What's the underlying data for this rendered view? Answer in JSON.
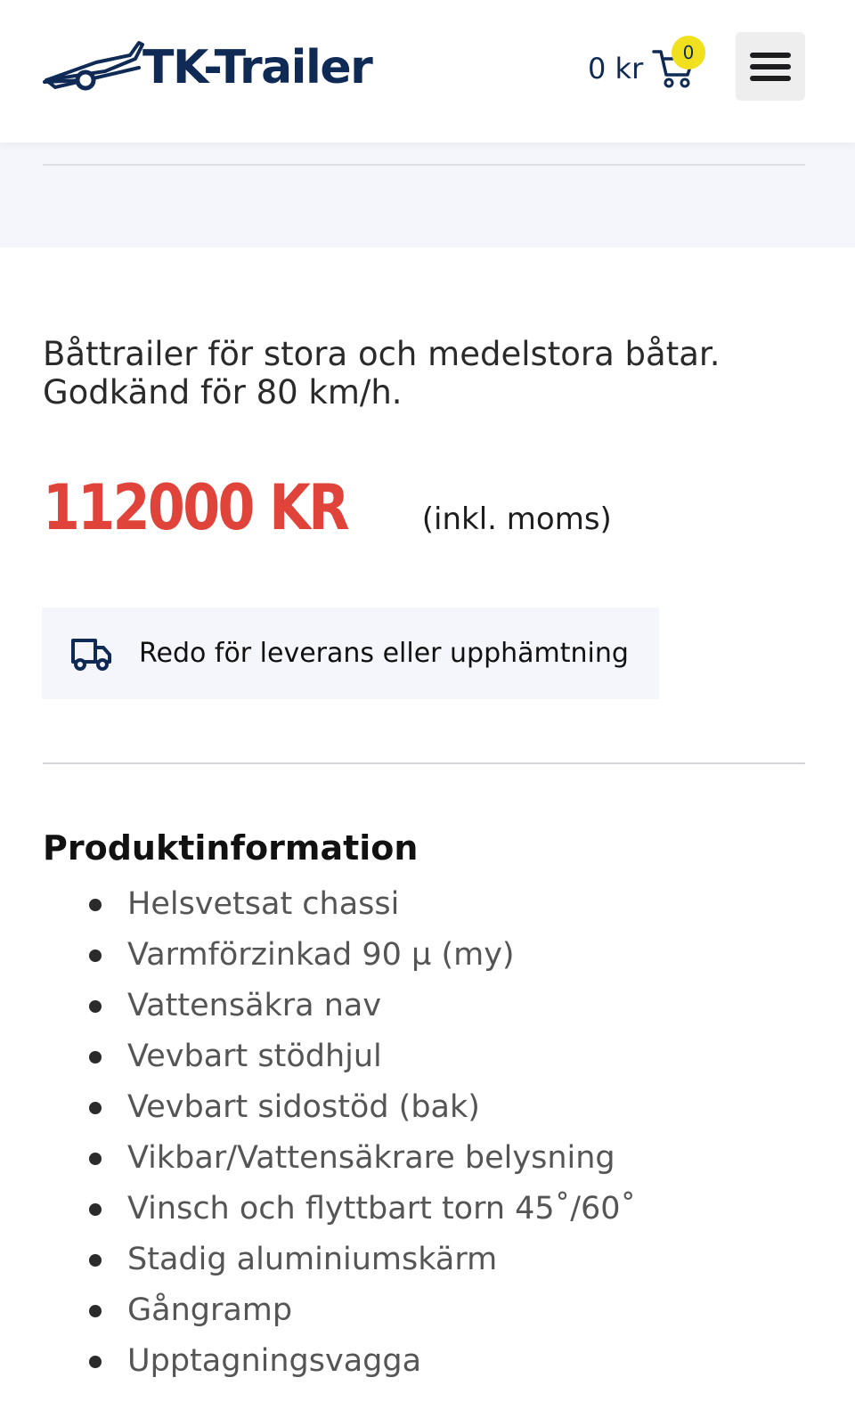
{
  "header": {
    "logo_text": "TK-Trailer",
    "cart_total": "0 kr",
    "cart_count": "0",
    "menu_icon": "hamburger-icon",
    "cart_icon": "shopping-cart-icon"
  },
  "product": {
    "description": "Båttrailer för stora och medelstora båtar. Godkänd för 80 km/h.",
    "price": "112000 KR",
    "vat_note": "(inkl. moms)",
    "delivery_icon": "truck-icon",
    "delivery_text": "Redo för leverans eller upphämtning"
  },
  "info": {
    "title": "Produktinformation",
    "features": [
      "Helsvetsat chassi",
      "Varmförzinkad 90 µ (my)",
      "Vattensäkra nav",
      "Vevbart stödhjul",
      "Vevbart sidostöd (bak)",
      "Vikbar/Vattensäkrare belysning",
      "Vinsch och flyttbart torn 45˚/60˚",
      "Stadig aluminiumskärm",
      "Gångramp",
      "Upptagningsvagga"
    ]
  },
  "colors": {
    "brand_navy": "#102a56",
    "price_red": "#e0433a",
    "badge_yellow": "#f1e01d",
    "band_bg": "#f4f6fb"
  }
}
